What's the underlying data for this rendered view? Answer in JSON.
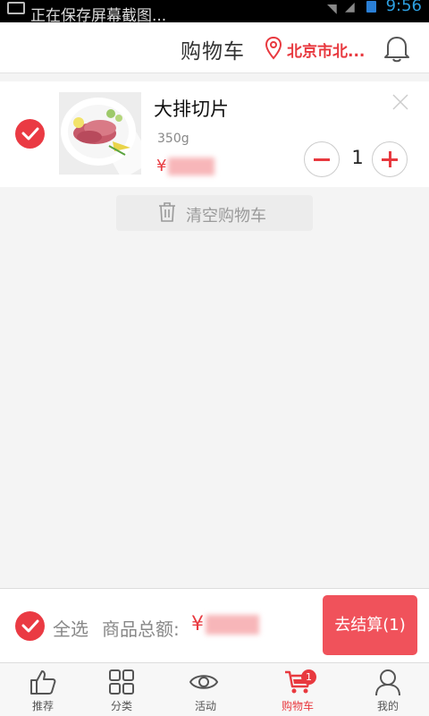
{
  "status_bar": {
    "notification_text": "正在保存屏幕截图...",
    "time": "9:56"
  },
  "header": {
    "title": "购物车",
    "location": "北京市北...",
    "location_icon": "map-pin-icon",
    "bell_icon": "bell-icon"
  },
  "cart": {
    "items": [
      {
        "name": "大排切片",
        "weight": "350g",
        "price_symbol": "¥",
        "quantity": "1",
        "selected": true
      }
    ],
    "clear_label": "清空购物车"
  },
  "action_bar": {
    "select_all_label": "全选",
    "total_label": "商品总额:",
    "total_symbol": "¥",
    "checkout_label": "去结算(1)"
  },
  "tabs": [
    {
      "label": "推荐",
      "icon": "thumbs-up-icon",
      "active": false
    },
    {
      "label": "分类",
      "icon": "grid-icon",
      "active": false
    },
    {
      "label": "活动",
      "icon": "eye-icon",
      "active": false
    },
    {
      "label": "购物车",
      "icon": "cart-icon",
      "active": true,
      "badge": "1"
    },
    {
      "label": "我的",
      "icon": "user-icon",
      "active": false
    }
  ],
  "colors": {
    "accent": "#e8393f",
    "checkout_bg": "#f0525b"
  }
}
